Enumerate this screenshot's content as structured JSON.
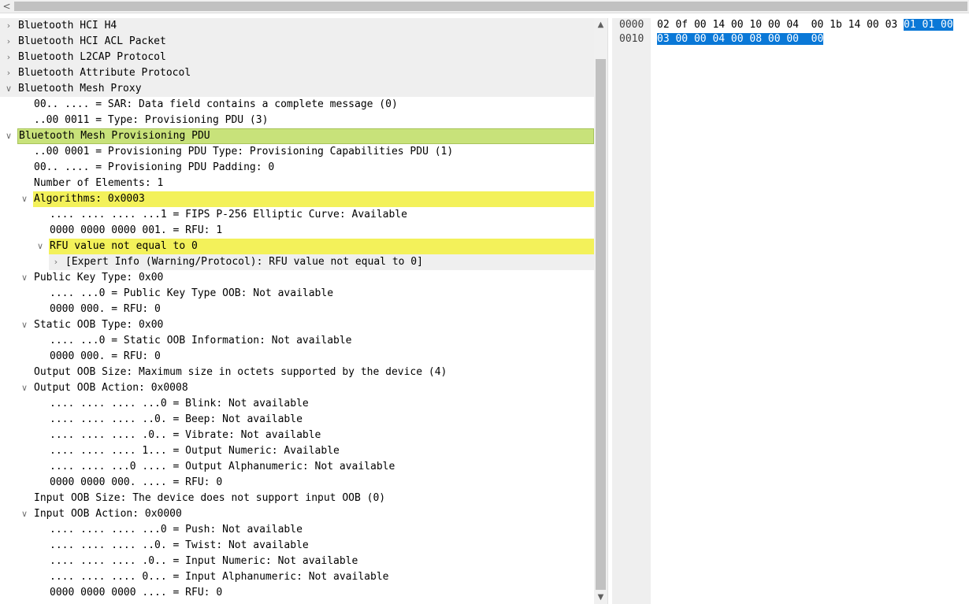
{
  "scrollbar_left_arrow": "<",
  "tree_rows": [
    {
      "indent": 0,
      "expander": ">",
      "text": "Bluetooth HCI H4",
      "style": "grey"
    },
    {
      "indent": 0,
      "expander": ">",
      "text": "Bluetooth HCI ACL Packet",
      "style": "grey"
    },
    {
      "indent": 0,
      "expander": ">",
      "text": "Bluetooth L2CAP Protocol",
      "style": "grey"
    },
    {
      "indent": 0,
      "expander": ">",
      "text": "Bluetooth Attribute Protocol",
      "style": "grey"
    },
    {
      "indent": 0,
      "expander": "v",
      "text": "Bluetooth Mesh Proxy",
      "style": "grey"
    },
    {
      "indent": 1,
      "expander": "",
      "text": "00.. .... = SAR: Data field contains a complete message (0)",
      "style": ""
    },
    {
      "indent": 1,
      "expander": "",
      "text": "..00 0011 = Type: Provisioning PDU (3)",
      "style": ""
    },
    {
      "indent": 0,
      "expander": "v",
      "text": "Bluetooth Mesh Provisioning PDU",
      "style": "green"
    },
    {
      "indent": 1,
      "expander": "",
      "text": "..00 0001 = Provisioning PDU Type: Provisioning Capabilities PDU (1)",
      "style": ""
    },
    {
      "indent": 1,
      "expander": "",
      "text": "00.. .... = Provisioning PDU Padding: 0",
      "style": ""
    },
    {
      "indent": 1,
      "expander": "",
      "text": "Number of Elements: 1",
      "style": ""
    },
    {
      "indent": 1,
      "expander": "v",
      "text": "Algorithms: 0x0003",
      "style": "yellow"
    },
    {
      "indent": 2,
      "expander": "",
      "text": ".... .... .... ...1 = FIPS P-256 Elliptic Curve: Available",
      "style": ""
    },
    {
      "indent": 2,
      "expander": "",
      "text": "0000 0000 0000 001. = RFU: 1",
      "style": ""
    },
    {
      "indent": 2,
      "expander": "v",
      "text": "RFU value not equal to 0",
      "style": "yellow"
    },
    {
      "indent": 3,
      "expander": ">",
      "text": "[Expert Info (Warning/Protocol): RFU value not equal to 0]",
      "style": "grey"
    },
    {
      "indent": 1,
      "expander": "v",
      "text": "Public Key Type: 0x00",
      "style": ""
    },
    {
      "indent": 2,
      "expander": "",
      "text": ".... ...0 = Public Key Type OOB: Not available",
      "style": ""
    },
    {
      "indent": 2,
      "expander": "",
      "text": "0000 000. = RFU: 0",
      "style": ""
    },
    {
      "indent": 1,
      "expander": "v",
      "text": "Static OOB Type: 0x00",
      "style": ""
    },
    {
      "indent": 2,
      "expander": "",
      "text": ".... ...0 = Static OOB Information: Not available",
      "style": ""
    },
    {
      "indent": 2,
      "expander": "",
      "text": "0000 000. = RFU: 0",
      "style": ""
    },
    {
      "indent": 1,
      "expander": "",
      "text": "Output OOB Size: Maximum size in octets supported by the device (4)",
      "style": ""
    },
    {
      "indent": 1,
      "expander": "v",
      "text": "Output OOB Action: 0x0008",
      "style": ""
    },
    {
      "indent": 2,
      "expander": "",
      "text": ".... .... .... ...0 = Blink: Not available",
      "style": ""
    },
    {
      "indent": 2,
      "expander": "",
      "text": ".... .... .... ..0. = Beep: Not available",
      "style": ""
    },
    {
      "indent": 2,
      "expander": "",
      "text": ".... .... .... .0.. = Vibrate: Not available",
      "style": ""
    },
    {
      "indent": 2,
      "expander": "",
      "text": ".... .... .... 1... = Output Numeric: Available",
      "style": ""
    },
    {
      "indent": 2,
      "expander": "",
      "text": ".... .... ...0 .... = Output Alphanumeric: Not available",
      "style": ""
    },
    {
      "indent": 2,
      "expander": "",
      "text": "0000 0000 000. .... = RFU: 0",
      "style": ""
    },
    {
      "indent": 1,
      "expander": "",
      "text": "Input OOB Size: The device does not support input OOB (0)",
      "style": ""
    },
    {
      "indent": 1,
      "expander": "v",
      "text": "Input OOB Action: 0x0000",
      "style": ""
    },
    {
      "indent": 2,
      "expander": "",
      "text": ".... .... .... ...0 = Push: Not available",
      "style": ""
    },
    {
      "indent": 2,
      "expander": "",
      "text": ".... .... .... ..0. = Twist: Not available",
      "style": ""
    },
    {
      "indent": 2,
      "expander": "",
      "text": ".... .... .... .0.. = Input Numeric: Not available",
      "style": ""
    },
    {
      "indent": 2,
      "expander": "",
      "text": ".... .... .... 0... = Input Alphanumeric: Not available",
      "style": ""
    },
    {
      "indent": 2,
      "expander": "",
      "text": "0000 0000 0000 .... = RFU: 0",
      "style": ""
    }
  ],
  "hex_rows": [
    {
      "offset": "0000",
      "plain": "02 0f 00 14 00 10 00 04  00 1b 14 00 03 ",
      "selected": "01 01 00"
    },
    {
      "offset": "0010",
      "plain": "",
      "selected": "03 00 00 04 00 08 00 00  00"
    }
  ],
  "colors": {
    "green_highlight": "#c8e27a",
    "yellow_highlight": "#f3f15a",
    "selection_blue": "#0a78d7",
    "grey_row": "#efefef"
  }
}
